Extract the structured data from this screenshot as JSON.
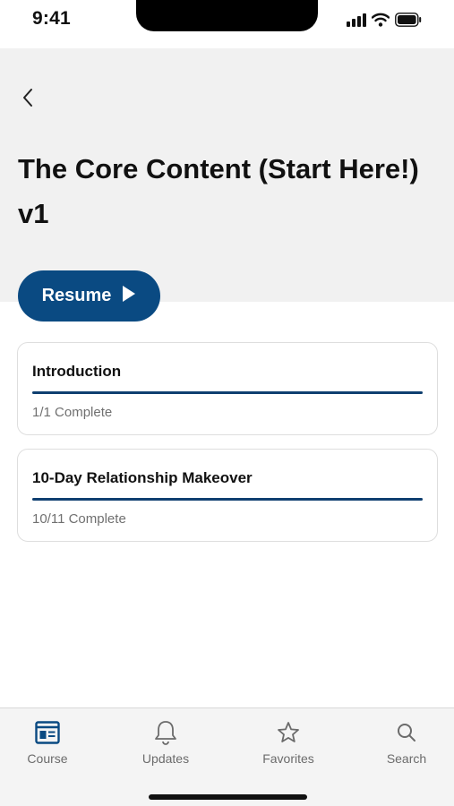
{
  "status_bar": {
    "time": "9:41"
  },
  "header": {
    "back_icon": "chevron-left-icon",
    "title": "The Core Content (Start Here!) v1"
  },
  "resume": {
    "label": "Resume",
    "icon": "play-icon"
  },
  "modules": [
    {
      "title": "Introduction",
      "status": "1/1 Complete",
      "progress": 1.0
    },
    {
      "title": "10-Day Relationship Makeover",
      "status": "10/11 Complete",
      "progress": 1.0
    }
  ],
  "tab_bar": {
    "tabs": [
      {
        "label": "Course",
        "icon": "course-icon",
        "active": true
      },
      {
        "label": "Updates",
        "icon": "bell-icon",
        "active": false
      },
      {
        "label": "Favorites",
        "icon": "star-icon",
        "active": false
      },
      {
        "label": "Search",
        "icon": "search-icon",
        "active": false
      }
    ]
  },
  "colors": {
    "accent": "#0a4a82",
    "progress": "#0f3f70",
    "header_bg": "#f1f1f1",
    "tab_inactive": "#6b6b6b"
  }
}
